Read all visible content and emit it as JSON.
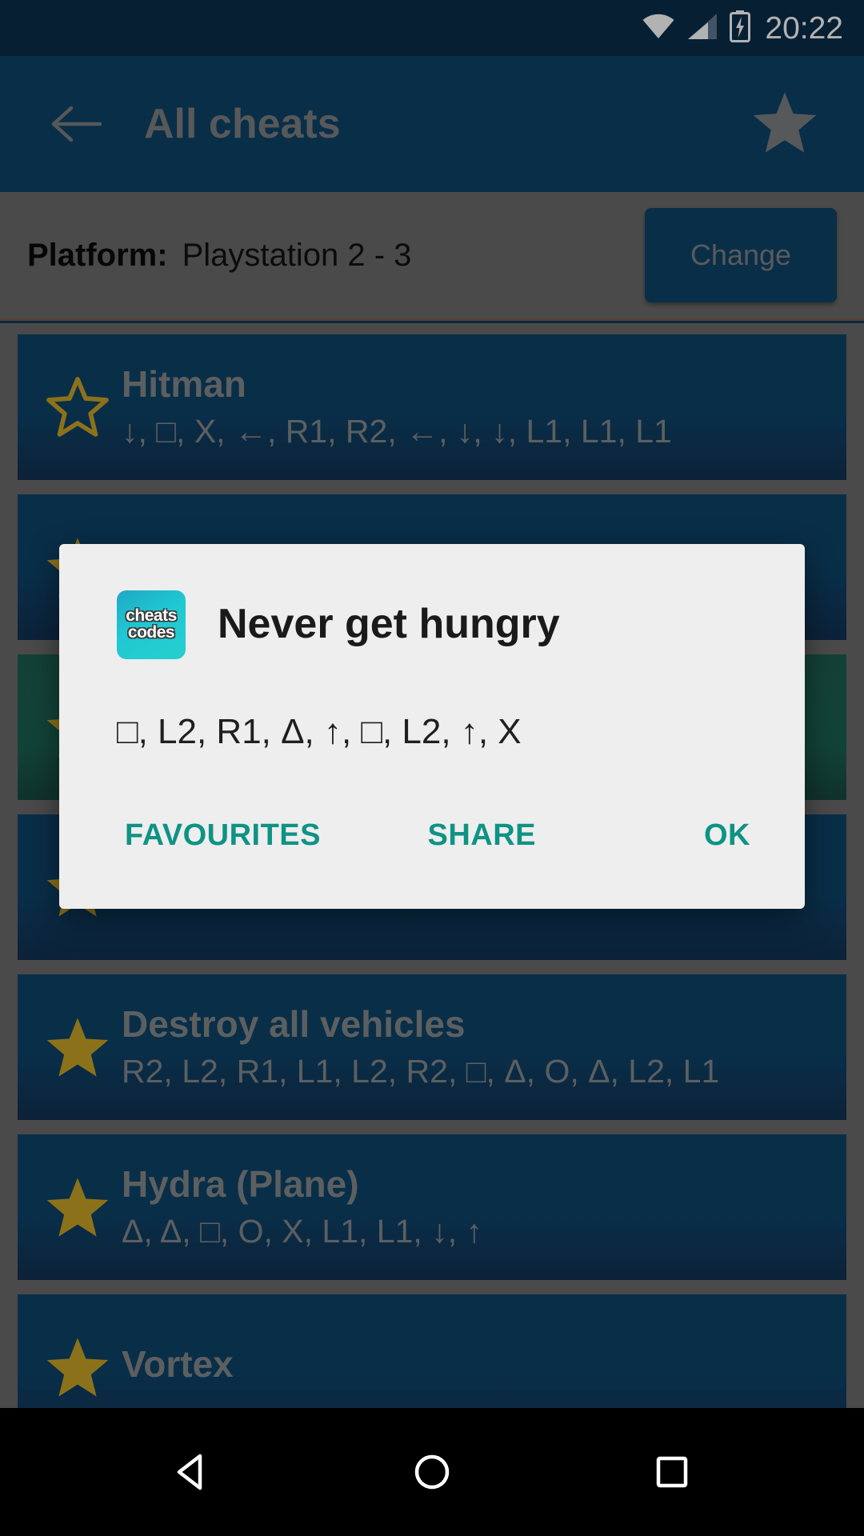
{
  "status_bar": {
    "time": "20:22",
    "icons": [
      "wifi-icon",
      "cellular-signal-icon",
      "battery-charging-icon"
    ]
  },
  "app_bar": {
    "back_icon": "back-arrow-icon",
    "title": "All cheats",
    "favourite_icon": "star-filled-icon"
  },
  "platform": {
    "label": "Platform:",
    "value": "Playstation 2 - 3",
    "change_label": "Change"
  },
  "cheat_list": [
    {
      "title": "Hitman",
      "code": "↓, □, X, ←, R1, R2, ←, ↓, ↓, L1, L1, L1",
      "starred": false
    },
    {
      "title": "",
      "code": "",
      "starred": true
    },
    {
      "title": "",
      "code": "",
      "starred": true
    },
    {
      "title": "",
      "code": "",
      "starred": true
    },
    {
      "title": "Destroy all vehicles",
      "code": "R2, L2, R1, L1, L2, R2, □, Δ, O, Δ, L2, L1",
      "starred": true
    },
    {
      "title": "Hydra (Plane)",
      "code": "Δ, Δ, □, O, X, L1, L1, ↓, ↑",
      "starred": true
    },
    {
      "title": "Vortex",
      "code": "",
      "starred": true
    }
  ],
  "dialog": {
    "icon_name": "cheats-codes-app-icon",
    "icon_text_line1": "cheats",
    "icon_text_line2": "codes",
    "title": "Never get hungry",
    "message": "□, L2, R1, Δ, ↑, □, L2, ↑, X",
    "buttons": {
      "favourites": "FAVOURITES",
      "share": "SHARE",
      "ok": "OK"
    }
  },
  "nav_bar": {
    "back": "nav-back-icon",
    "home": "nav-home-icon",
    "recents": "nav-recents-icon"
  },
  "colors": {
    "status_bar_bg": "#0B2D4A",
    "app_bar_bg": "#0E4268",
    "card_bg": "#0E4268",
    "scrim": "#6B6B6B",
    "dialog_bg": "#EEEEEE",
    "accent_teal": "#0E9384",
    "star_gold": "#C9A227",
    "muted_text": "#85888A"
  }
}
